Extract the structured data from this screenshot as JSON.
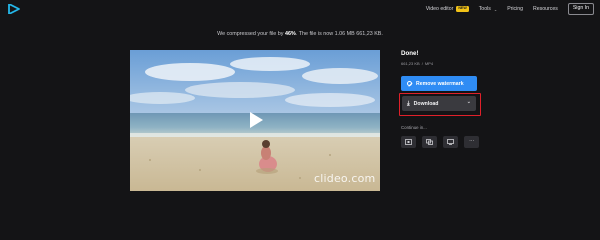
{
  "colors": {
    "background": "#141416",
    "accent": "#2f8cf4",
    "highlight_frame": "#e0202a",
    "badge": "#f2c318"
  },
  "header": {
    "logo_icon": "play-triangle-logo",
    "nav": {
      "video_editor": "Video editor",
      "video_editor_badge": "NEW",
      "tools": "Tools",
      "pricing": "Pricing",
      "resources": "Resources",
      "sign_in": "Sign In"
    }
  },
  "banner": {
    "prefix": "We compressed your file by",
    "percent": "46%",
    "suffix": ". The file is now 1.06 MB 661,23 KB."
  },
  "video": {
    "play_icon": "play-icon",
    "watermark": "clideo.com"
  },
  "result": {
    "title": "Done!",
    "file_size": "661,23 KB",
    "separator": "/",
    "format": "MP4"
  },
  "actions": {
    "remove_watermark": "Remove watermark",
    "download": "Download",
    "continue_label": "Continue in...",
    "tools": [
      "edit-icon",
      "copy-icon",
      "screen-icon",
      "more-icon"
    ],
    "more_glyph": "···"
  }
}
